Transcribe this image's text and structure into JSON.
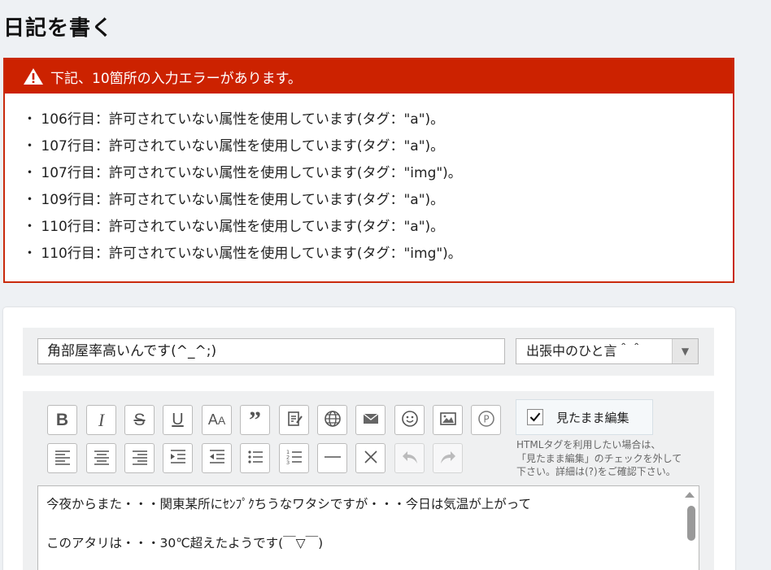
{
  "page": {
    "title": "日記を書く"
  },
  "errors": {
    "header": "下記、10箇所の入力エラーがあります。",
    "items": [
      "・ 106行目：許可されていない属性を使用しています(タグ：\"a\")。",
      "・ 107行目：許可されていない属性を使用しています(タグ：\"a\")。",
      "・ 107行目：許可されていない属性を使用しています(タグ：\"img\")。",
      "・ 109行目：許可されていない属性を使用しています(タグ：\"a\")。",
      "・ 110行目：許可されていない属性を使用しています(タグ：\"a\")。",
      "・ 110行目：許可されていない属性を使用しています(タグ：\"img\")。"
    ]
  },
  "form": {
    "title_value": "角部屋率高いんです(^_^;)",
    "category_value": "出張中のひと言＾＾"
  },
  "toolbar": {
    "row1": [
      "bold-icon",
      "italic-icon",
      "strikethrough-icon",
      "underline-icon",
      "font-size-icon",
      "quote-icon",
      "edit-doc-icon",
      "globe-icon",
      "mail-icon",
      "smiley-icon",
      "image-icon",
      "p-circle-icon"
    ],
    "row2": [
      "align-left-icon",
      "align-center-icon",
      "align-right-icon",
      "indent-icon",
      "outdent-icon",
      "bullet-list-icon",
      "numbered-list-icon",
      "horizontal-rule-icon",
      "clear-format-icon",
      "undo-icon",
      "redo-icon"
    ],
    "wysiwyg_label": "見たまま編集",
    "wysiwyg_checked": true,
    "help_text": [
      "HTMLタグを利用したい場合は、",
      "「見たまま編集」のチェックを外して",
      "下さい。詳細は(?)をご確認下さい。"
    ]
  },
  "body": {
    "lines": [
      "今夜からまた・・・関東某所にｾﾝﾌﾟｸちうなワタシですが・・・今日は気温が上がって",
      "このアタリは・・・30℃超えたようです(￣▽￣)"
    ]
  },
  "colors": {
    "error_red": "#cc2200",
    "background": "#eef1f4",
    "panel_grey": "#eff0f1"
  }
}
